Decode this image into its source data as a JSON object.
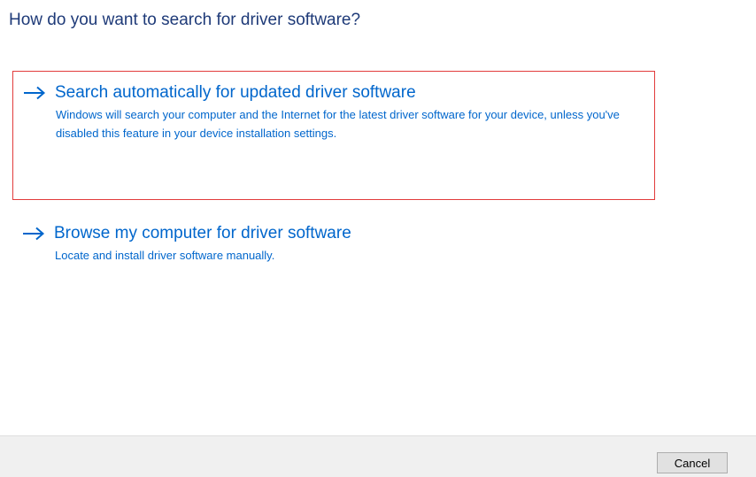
{
  "dialog": {
    "title": "How do you want to search for driver software?"
  },
  "options": [
    {
      "icon": "arrow-right-icon",
      "title": "Search automatically for updated driver software",
      "description": "Windows will search your computer and the Internet for the latest driver software for your device, unless you've disabled this feature in your device installation settings.",
      "highlighted": true
    },
    {
      "icon": "arrow-right-icon",
      "title": "Browse my computer for driver software",
      "description": "Locate and install driver software manually.",
      "highlighted": false
    }
  ],
  "footer": {
    "cancel_label": "Cancel"
  },
  "colors": {
    "title": "#1e3a78",
    "link": "#0066cc",
    "highlight_border": "#e23b3b",
    "footer_bg": "#f0f0f0"
  }
}
